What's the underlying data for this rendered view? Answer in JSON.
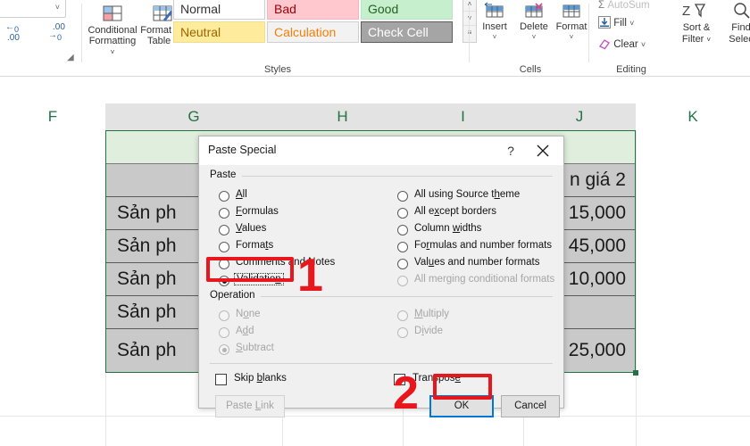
{
  "ribbon": {
    "groups": [
      {
        "name": "number",
        "label": ""
      },
      {
        "name": "styles",
        "label": "Styles"
      },
      {
        "name": "cells",
        "label": "Cells"
      },
      {
        "name": "editing",
        "label": "Editing"
      }
    ],
    "number": {
      "increase_decimal_icon": "increase-decimal-icon",
      "decrease_decimal_icon": "decrease-decimal-icon",
      "dialog_launcher_icon": "dialog-launcher-icon"
    },
    "styles": {
      "conditional_formatting": "Conditional Formatting",
      "conditional_formatting_line1": "Conditional",
      "conditional_formatting_line2": "Formatting",
      "format_as_table": "Format as Table",
      "format_as_table_line1": "Format as",
      "format_as_table_line2": "Table",
      "gallery": [
        {
          "label": "Normal",
          "bg": "#ffffff",
          "fg": "#333333",
          "border": "#cfcfcf"
        },
        {
          "label": "Bad",
          "bg": "#ffc7ce",
          "fg": "#9c0006",
          "border": "#f3b7bf"
        },
        {
          "label": "Good",
          "bg": "#c6efce",
          "fg": "#276221",
          "border": "#b7e5c0"
        },
        {
          "label": "Neutral",
          "bg": "#ffeb9c",
          "fg": "#9c6500",
          "border": "#f2dd8e"
        },
        {
          "label": "Calculation",
          "bg": "#f2f2f2",
          "fg": "#fa7d00",
          "border": "#cfcfcf"
        },
        {
          "label": "Check Cell",
          "bg": "#a5a5a5",
          "fg": "#ffffff",
          "border": "#5c5c5c"
        }
      ],
      "scroll_up": "˄",
      "scroll_down": "˅",
      "scroll_more": "≡"
    },
    "cells": {
      "items": [
        {
          "label": "Insert",
          "icon": "insert-cells-icon",
          "caret": "˅"
        },
        {
          "label": "Delete",
          "icon": "delete-cells-icon",
          "caret": "˅"
        },
        {
          "label": "Format",
          "icon": "format-cells-icon",
          "caret": "˅"
        }
      ]
    },
    "editing": {
      "autosum": "AutoSum",
      "fill": "Fill",
      "clear": "Clear",
      "sort_filter_line1": "Sort &",
      "sort_filter_line2": "Filter",
      "find_select_line1": "Find",
      "find_select_line2": "Selec",
      "caret": "˅"
    }
  },
  "sheet": {
    "columns": [
      {
        "label": "F",
        "selected": false
      },
      {
        "label": "G",
        "selected": true
      },
      {
        "label": "H",
        "selected": true
      },
      {
        "label": "I",
        "selected": true
      },
      {
        "label": "J",
        "selected": true
      },
      {
        "label": "K",
        "selected": false
      }
    ],
    "rows": [
      {
        "left": "",
        "right": "",
        "header": true
      },
      {
        "left": "",
        "right": "n giá 2",
        "header": false
      },
      {
        "left": "Sản ph",
        "right": "15,000",
        "header": false
      },
      {
        "left": "Sản ph",
        "right": "45,000",
        "header": false
      },
      {
        "left": "Sản ph",
        "right": "10,000",
        "header": false
      },
      {
        "left": "Sản ph",
        "right": "",
        "header": false
      },
      {
        "left": "Sản ph",
        "right": "25,000",
        "header": false
      }
    ]
  },
  "dialog": {
    "title": "Paste Special",
    "help_icon": "help-icon",
    "close_icon": "close-icon",
    "paste_group_label": "Paste",
    "operation_group_label": "Operation",
    "paste_left": [
      {
        "label": "All",
        "accel": "A",
        "checked": false,
        "disabled": false
      },
      {
        "label": "Formulas",
        "accel": "F",
        "checked": false,
        "disabled": false
      },
      {
        "label": "Values",
        "accel": "V",
        "checked": false,
        "disabled": false
      },
      {
        "label": "Formats",
        "accel": "t",
        "checked": false,
        "disabled": false
      },
      {
        "label": "Comments and Notes",
        "accel": "",
        "checked": false,
        "disabled": false
      },
      {
        "label": "Validation",
        "accel": "n",
        "checked": true,
        "disabled": false
      }
    ],
    "paste_right": [
      {
        "label": "All using Source theme",
        "accel": "h",
        "checked": false,
        "disabled": false
      },
      {
        "label": "All except borders",
        "accel": "x",
        "checked": false,
        "disabled": false
      },
      {
        "label": "Column widths",
        "accel": "w",
        "checked": false,
        "disabled": false
      },
      {
        "label": "Formulas and number formats",
        "accel": "r",
        "checked": false,
        "disabled": false
      },
      {
        "label": "Values and number formats",
        "accel": "u",
        "checked": false,
        "disabled": false
      },
      {
        "label": "All merging conditional formats",
        "accel": "",
        "checked": false,
        "disabled": true
      }
    ],
    "operation_left": [
      {
        "label": "None",
        "accel": "o",
        "checked": false,
        "disabled": true
      },
      {
        "label": "Add",
        "accel": "d",
        "checked": false,
        "disabled": true
      },
      {
        "label": "Subtract",
        "accel": "S",
        "checked": true,
        "disabled": true
      }
    ],
    "operation_right": [
      {
        "label": "Multiply",
        "accel": "M",
        "checked": false,
        "disabled": true
      },
      {
        "label": "Divide",
        "accel": "i",
        "checked": false,
        "disabled": true
      }
    ],
    "skip_blanks": {
      "label": "Skip blanks",
      "accel": "b",
      "checked": false
    },
    "transpose": {
      "label": "Transpose",
      "accel": "e",
      "checked": false
    },
    "paste_link_button": "Paste Link",
    "paste_link_accel": "L",
    "ok_button": "OK",
    "cancel_button": "Cancel"
  },
  "annotations": {
    "step_one": "1",
    "step_two": "2",
    "highlight_color": "#e8161d"
  }
}
